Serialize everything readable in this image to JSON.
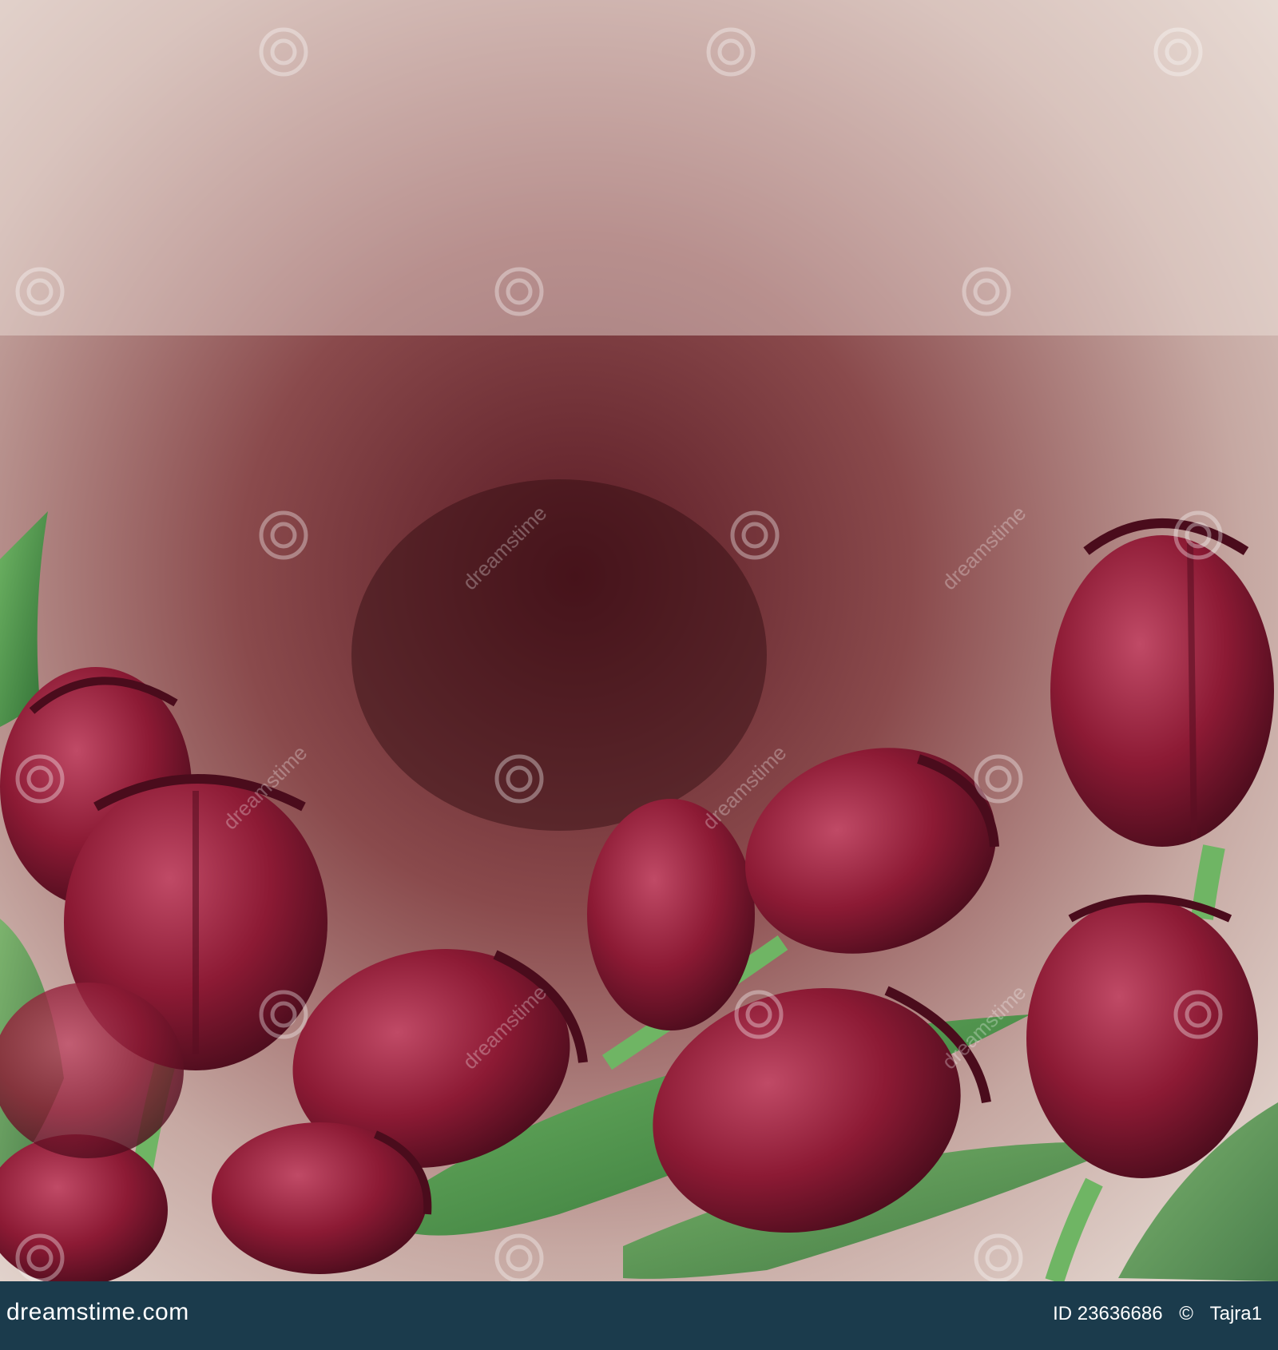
{
  "photo": {
    "subject_icon": "tulip-icon",
    "watermark_icon": "spiral-watermark-icon",
    "watermark_text": "dreamstime",
    "colors": {
      "tulip": "#8c1a34",
      "tulip_dark": "#4a0c1c",
      "leaf": "#3f8a3a",
      "background_light": "#e7dbd4",
      "background_dark": "#4e1a22"
    }
  },
  "footer": {
    "logo": "dreamstime.com",
    "image_id": "ID 23636686",
    "separator": "©",
    "author": "Tajra1",
    "background_color": "#1b3b4c"
  }
}
